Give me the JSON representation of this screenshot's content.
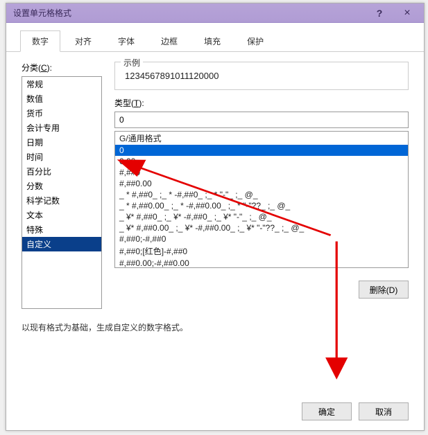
{
  "title": "设置单元格格式",
  "titlebar": {
    "help": "?",
    "close": "×"
  },
  "tabs": [
    {
      "label": "数字",
      "active": true
    },
    {
      "label": "对齐",
      "active": false
    },
    {
      "label": "字体",
      "active": false
    },
    {
      "label": "边框",
      "active": false
    },
    {
      "label": "填充",
      "active": false
    },
    {
      "label": "保护",
      "active": false
    }
  ],
  "category": {
    "label_prefix": "分类(",
    "label_hotkey": "C",
    "label_suffix": "):",
    "items": [
      "常规",
      "数值",
      "货币",
      "会计专用",
      "日期",
      "时间",
      "百分比",
      "分数",
      "科学记数",
      "文本",
      "特殊",
      "自定义"
    ],
    "selected_index": 11
  },
  "sample": {
    "legend": "示例",
    "value": "1234567891011120000"
  },
  "type": {
    "label_prefix": "类型(",
    "label_hotkey": "T",
    "label_suffix": "):",
    "input_value": "0",
    "items": [
      "G/通用格式",
      "0",
      "0.00",
      "#,##0",
      "#,##0.00",
      "_ * #,##0_ ;_ * -#,##0_ ;_ * \"-\"_ ;_ @_ ",
      "_ * #,##0.00_ ;_ * -#,##0.00_ ;_ * \"-\"??_ ;_ @_ ",
      "_ ¥* #,##0_ ;_ ¥* -#,##0_ ;_ ¥* \"-\"_ ;_ @_ ",
      "_ ¥* #,##0.00_ ;_ ¥* -#,##0.00_ ;_ ¥* \"-\"??_ ;_ @_ ",
      "#,##0;-#,##0",
      "#,##0;[红色]-#,##0",
      "#,##0.00;-#,##0.00"
    ],
    "selected_index": 1
  },
  "buttons": {
    "delete": "删除(D)",
    "ok": "确定",
    "cancel": "取消"
  },
  "hint": "以现有格式为基础，生成自定义的数字格式。"
}
